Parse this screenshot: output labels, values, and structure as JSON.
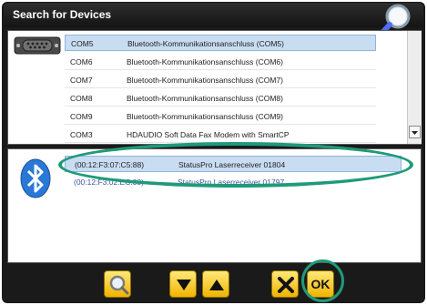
{
  "window": {
    "title": "Search for Devices"
  },
  "ports": [
    {
      "port": "COM5",
      "description": "Bluetooth-Kommunikationsanschluss (COM5)",
      "selected": true
    },
    {
      "port": "COM6",
      "description": "Bluetooth-Kommunikationsanschluss (COM6)",
      "selected": false
    },
    {
      "port": "COM7",
      "description": "Bluetooth-Kommunikationsanschluss (COM7)",
      "selected": false
    },
    {
      "port": "COM8",
      "description": "Bluetooth-Kommunikationsanschluss (COM8)",
      "selected": false
    },
    {
      "port": "COM9",
      "description": "Bluetooth-Kommunikationsanschluss (COM9)",
      "selected": false
    },
    {
      "port": "COM3",
      "description": "HDAUDIO Soft Data Fax Modem with SmartCP",
      "selected": false
    }
  ],
  "devices": [
    {
      "address": "(00:12:F3:07:C5:88)",
      "name": "StatusPro Laserreceiver 01804",
      "selected": true
    },
    {
      "address": "(00:12:F3:02:EC:39)",
      "name": "StatusPro Laserreceiver 01797",
      "selected": false
    }
  ],
  "toolbar": {
    "ok_label": "OK"
  },
  "colors": {
    "accent": "#1f9a79",
    "button_yellow": "#f0b300",
    "bluetooth_blue": "#2a78d6",
    "selection": "#c9ddf2"
  },
  "icons": {
    "search": "magnifier-icon",
    "port": "serial-port-icon",
    "bluetooth": "bluetooth-icon",
    "scroll_down": "chevron-down-icon",
    "toolbar": [
      "magnifier-icon",
      "arrow-down-icon",
      "arrow-up-icon",
      "close-icon"
    ]
  }
}
